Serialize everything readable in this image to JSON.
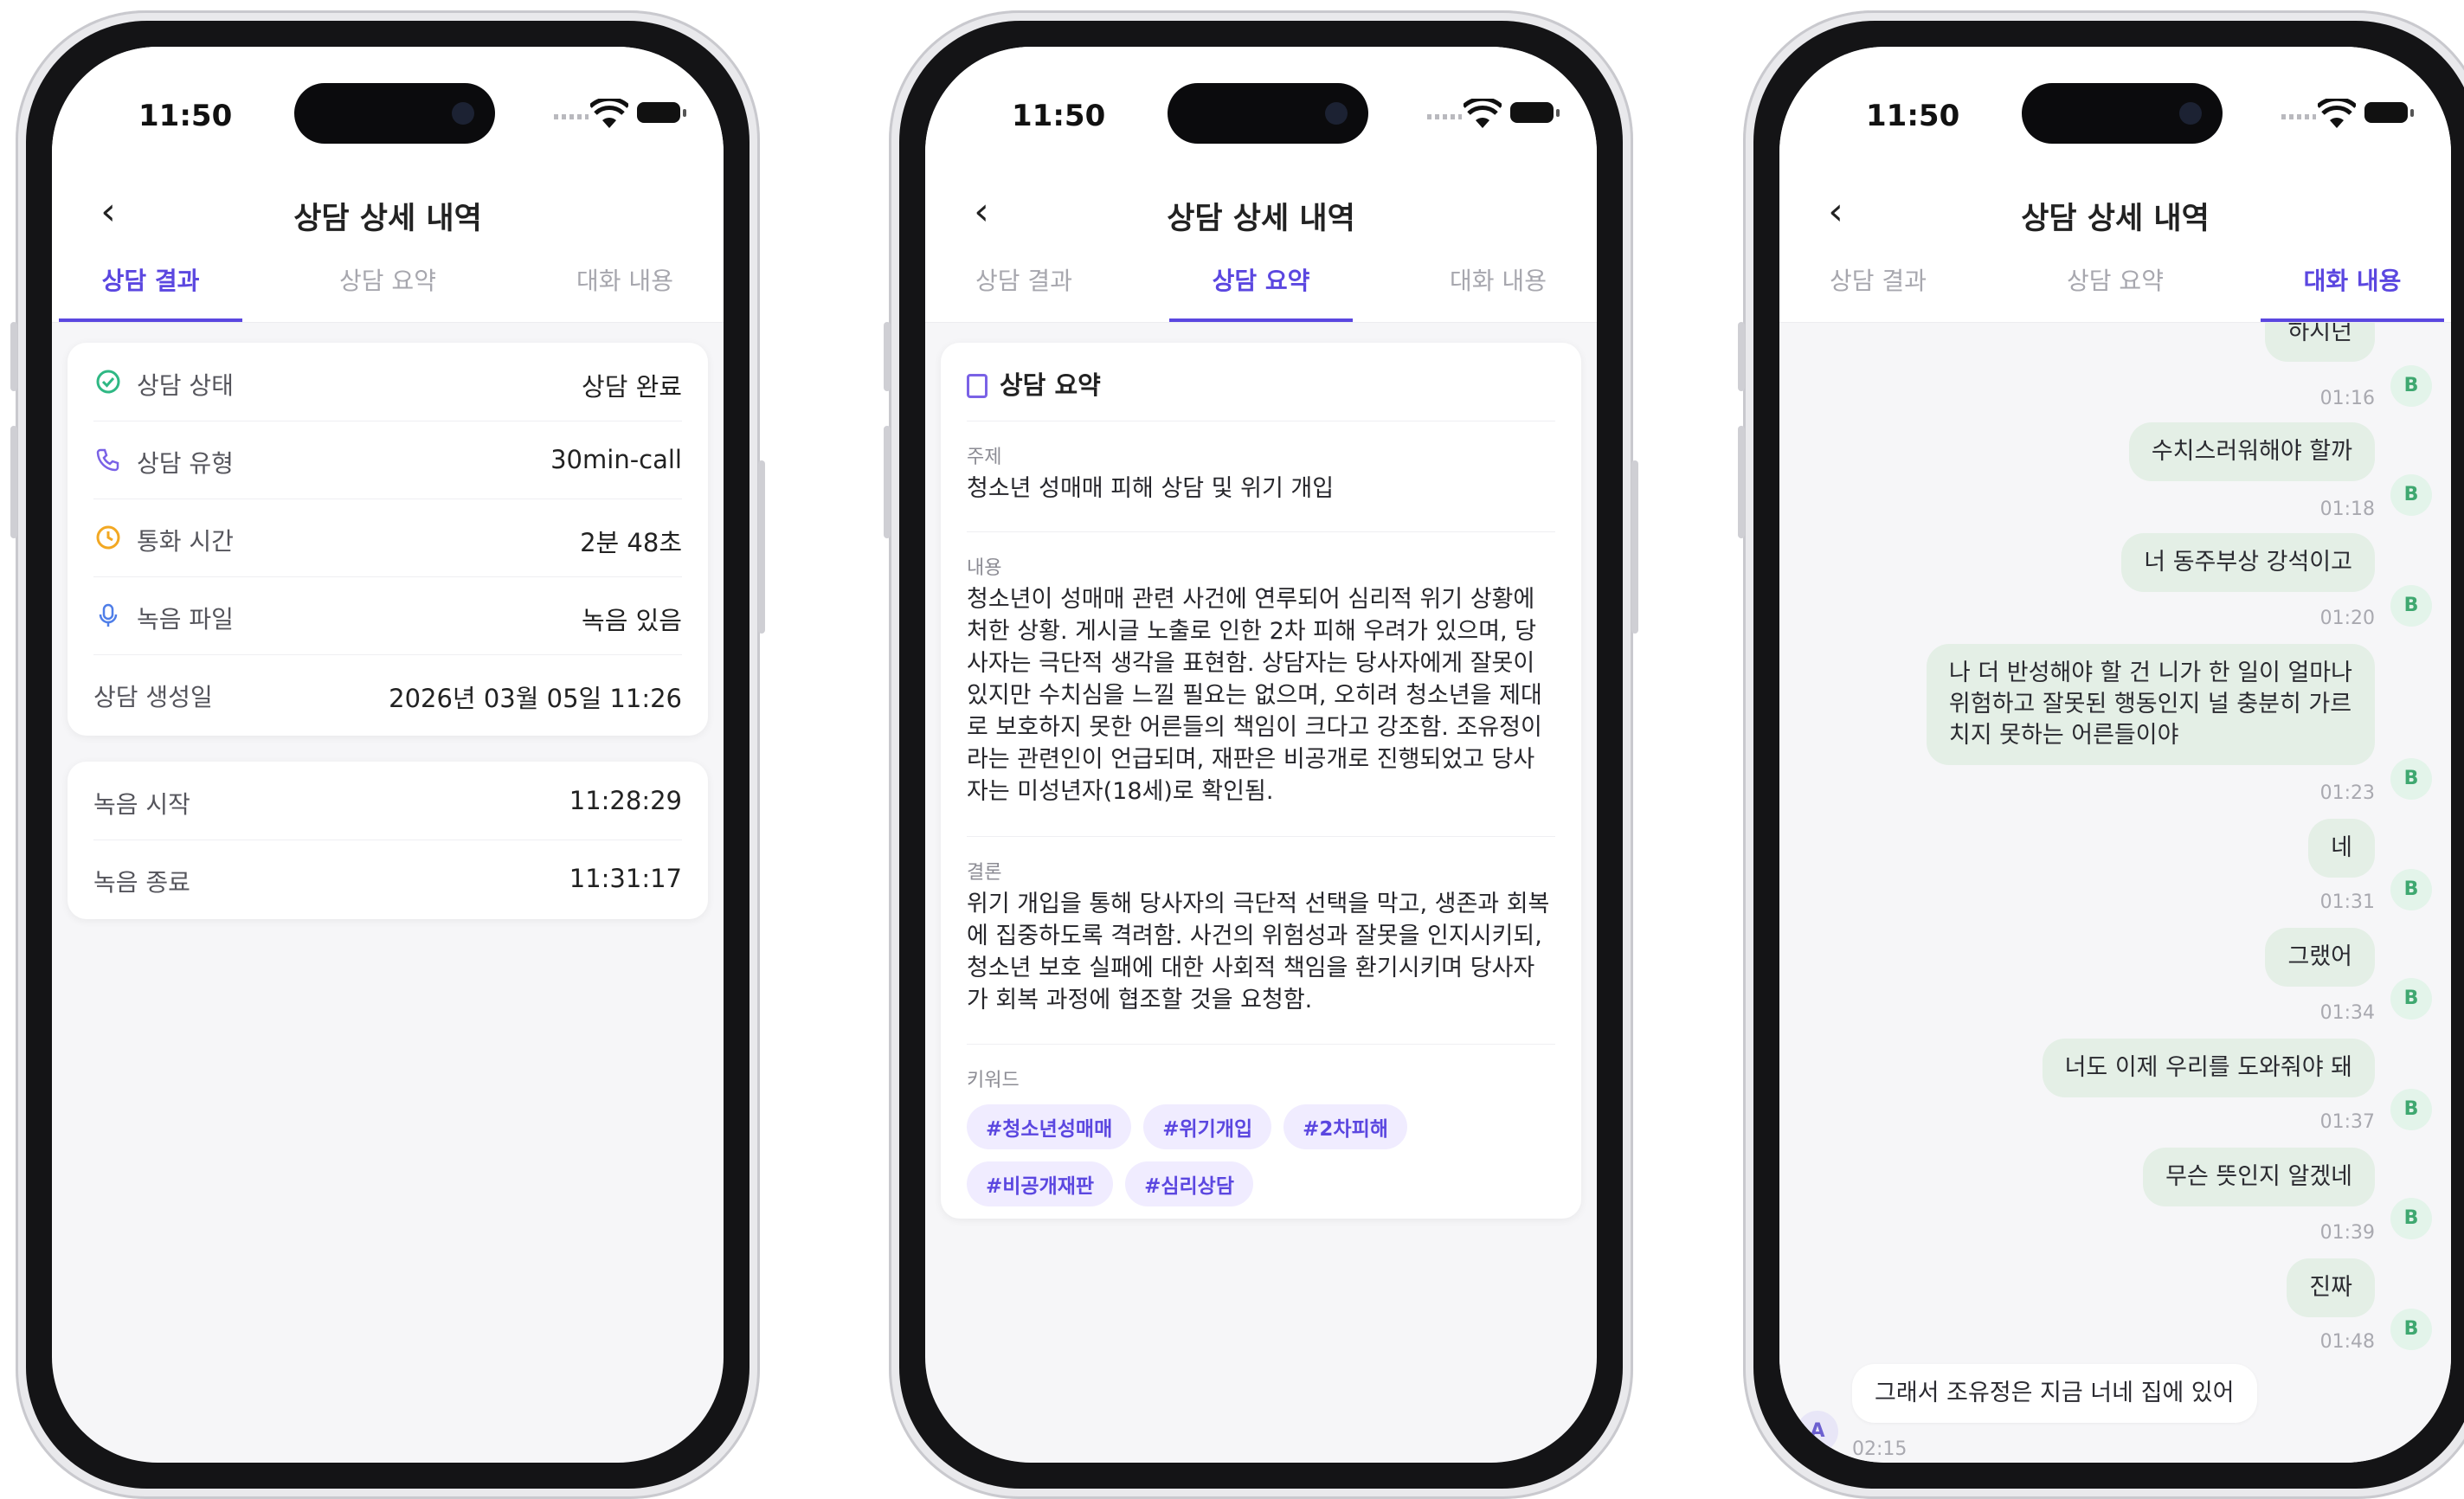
{
  "status": {
    "time": "11:50"
  },
  "header": {
    "title": "상담 상세 내역"
  },
  "tabs": [
    "상담 결과",
    "상담 요약",
    "대화 내용"
  ],
  "result": {
    "rows": [
      {
        "label": "상담 상태",
        "value": "상담 완료",
        "icon": "check-circle-icon",
        "color": "#2fb884"
      },
      {
        "label": "상담 유형",
        "value": "30min-call",
        "icon": "phone-icon",
        "color": "#7a62e6"
      },
      {
        "label": "통화 시간",
        "value": "2분 48초",
        "icon": "clock-icon",
        "color": "#f2a823"
      },
      {
        "label": "녹음 파일",
        "value": "녹음 있음",
        "icon": "mic-icon",
        "color": "#4f7ee8"
      },
      {
        "label": "상담 생성일",
        "value": "2026년 03월 05일 11:26"
      }
    ],
    "recording": [
      {
        "label": "녹음 시작",
        "value": "11:28:29"
      },
      {
        "label": "녹음 종료",
        "value": "11:31:17"
      }
    ]
  },
  "summary": {
    "heading": "상담 요약",
    "topic_label": "주제",
    "topic": "청소년 성매매 피해 상담 및 위기 개입",
    "content_label": "내용",
    "content": "청소년이 성매매 관련 사건에 연루되어 심리적 위기 상황에 처한 상황. 게시글 노출로 인한 2차 피해 우려가 있으며, 당사자는 극단적 생각을 표현함. 상담자는 당사자에게 잘못이 있지만 수치심을 느낄 필요는 없으며, 오히려 청소년을 제대로 보호하지 못한 어른들의 책임이 크다고 강조함. 조유정이라는 관련인이 언급되며, 재판은 비공개로 진행되었고 당사자는 미성년자(18세)로 확인됨.",
    "conclusion_label": "결론",
    "conclusion": "위기 개입을 통해 당사자의 극단적 선택을 막고, 생존과 회복에 집중하도록 격려함. 사건의 위험성과 잘못을 인지시키되, 청소년 보호 실패에 대한 사회적 책임을 환기시키며 당사자가 회복 과정에 협조할 것을 요청함.",
    "keywords_label": "키워드",
    "keywords": [
      "#청소년성매매",
      "#위기개입",
      "#2차피해",
      "#비공개재판",
      "#심리상담"
    ]
  },
  "chat": {
    "partial_top": "하시던",
    "messages": [
      {
        "side": "B",
        "text": "",
        "time": "01:16"
      },
      {
        "side": "B",
        "text": "수치스러워해야 할까",
        "time": "01:18"
      },
      {
        "side": "B",
        "text": "너 동주부상 강석이고",
        "time": "01:20"
      },
      {
        "side": "B",
        "text": "나 더 반성해야 할 건 니가 한 일이 얼마나\n위험하고 잘못된 행동인지 널 충분히 가르\n치지 못하는 어른들이야",
        "time": "01:23"
      },
      {
        "side": "B",
        "text": "네",
        "time": "01:31"
      },
      {
        "side": "B",
        "text": "그랬어",
        "time": "01:34"
      },
      {
        "side": "B",
        "text": "너도 이제 우리를 도와줘야 돼",
        "time": "01:37"
      },
      {
        "side": "B",
        "text": "무슨 뜻인지 알겠네",
        "time": "01:39"
      },
      {
        "side": "B",
        "text": "진짜",
        "time": "01:48"
      },
      {
        "side": "A",
        "text": "그래서 조유정은 지금 너네 집에 있어",
        "time": "02:15"
      }
    ],
    "avatar_b": "B",
    "avatar_a": "A"
  }
}
